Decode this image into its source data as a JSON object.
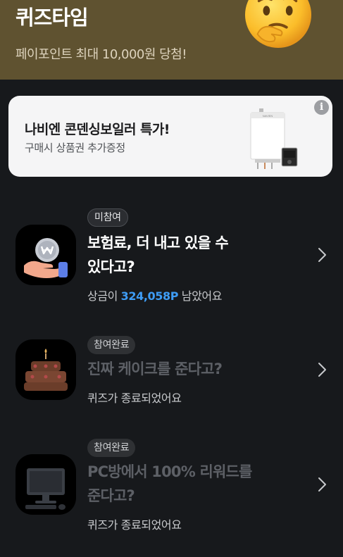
{
  "header": {
    "title": "퀴즈타임",
    "subtitle": "페이포인트 최대 10,000원 당첨!"
  },
  "ad": {
    "title": "나비엔 콘덴싱보일러 특가!",
    "subtitle": "구매시 상품권 추가증정",
    "info_icon": "i"
  },
  "quizzes": [
    {
      "badge": "미참여",
      "title_line1": "보험료, 더 내고 있을 수",
      "title_line2": "있다고?",
      "status_prefix": "상금이 ",
      "prize": "324,058P",
      "status_suffix": " 남았어요",
      "icon": "hand-coin-icon"
    },
    {
      "badge": "참여완료",
      "title_line1": "진짜 케이크를 준다고?",
      "status": "퀴즈가 종료되었어요",
      "icon": "cake-icon"
    },
    {
      "badge": "참여완료",
      "title_line1": "PC방에서 100% 리워드를",
      "title_line2": "준다고?",
      "status": "퀴즈가 종료되었어요",
      "icon": "computer-icon"
    }
  ],
  "colors": {
    "header_bg": "#5f5230",
    "page_bg": "#17191c",
    "prize_accent": "#3e9cf5"
  }
}
